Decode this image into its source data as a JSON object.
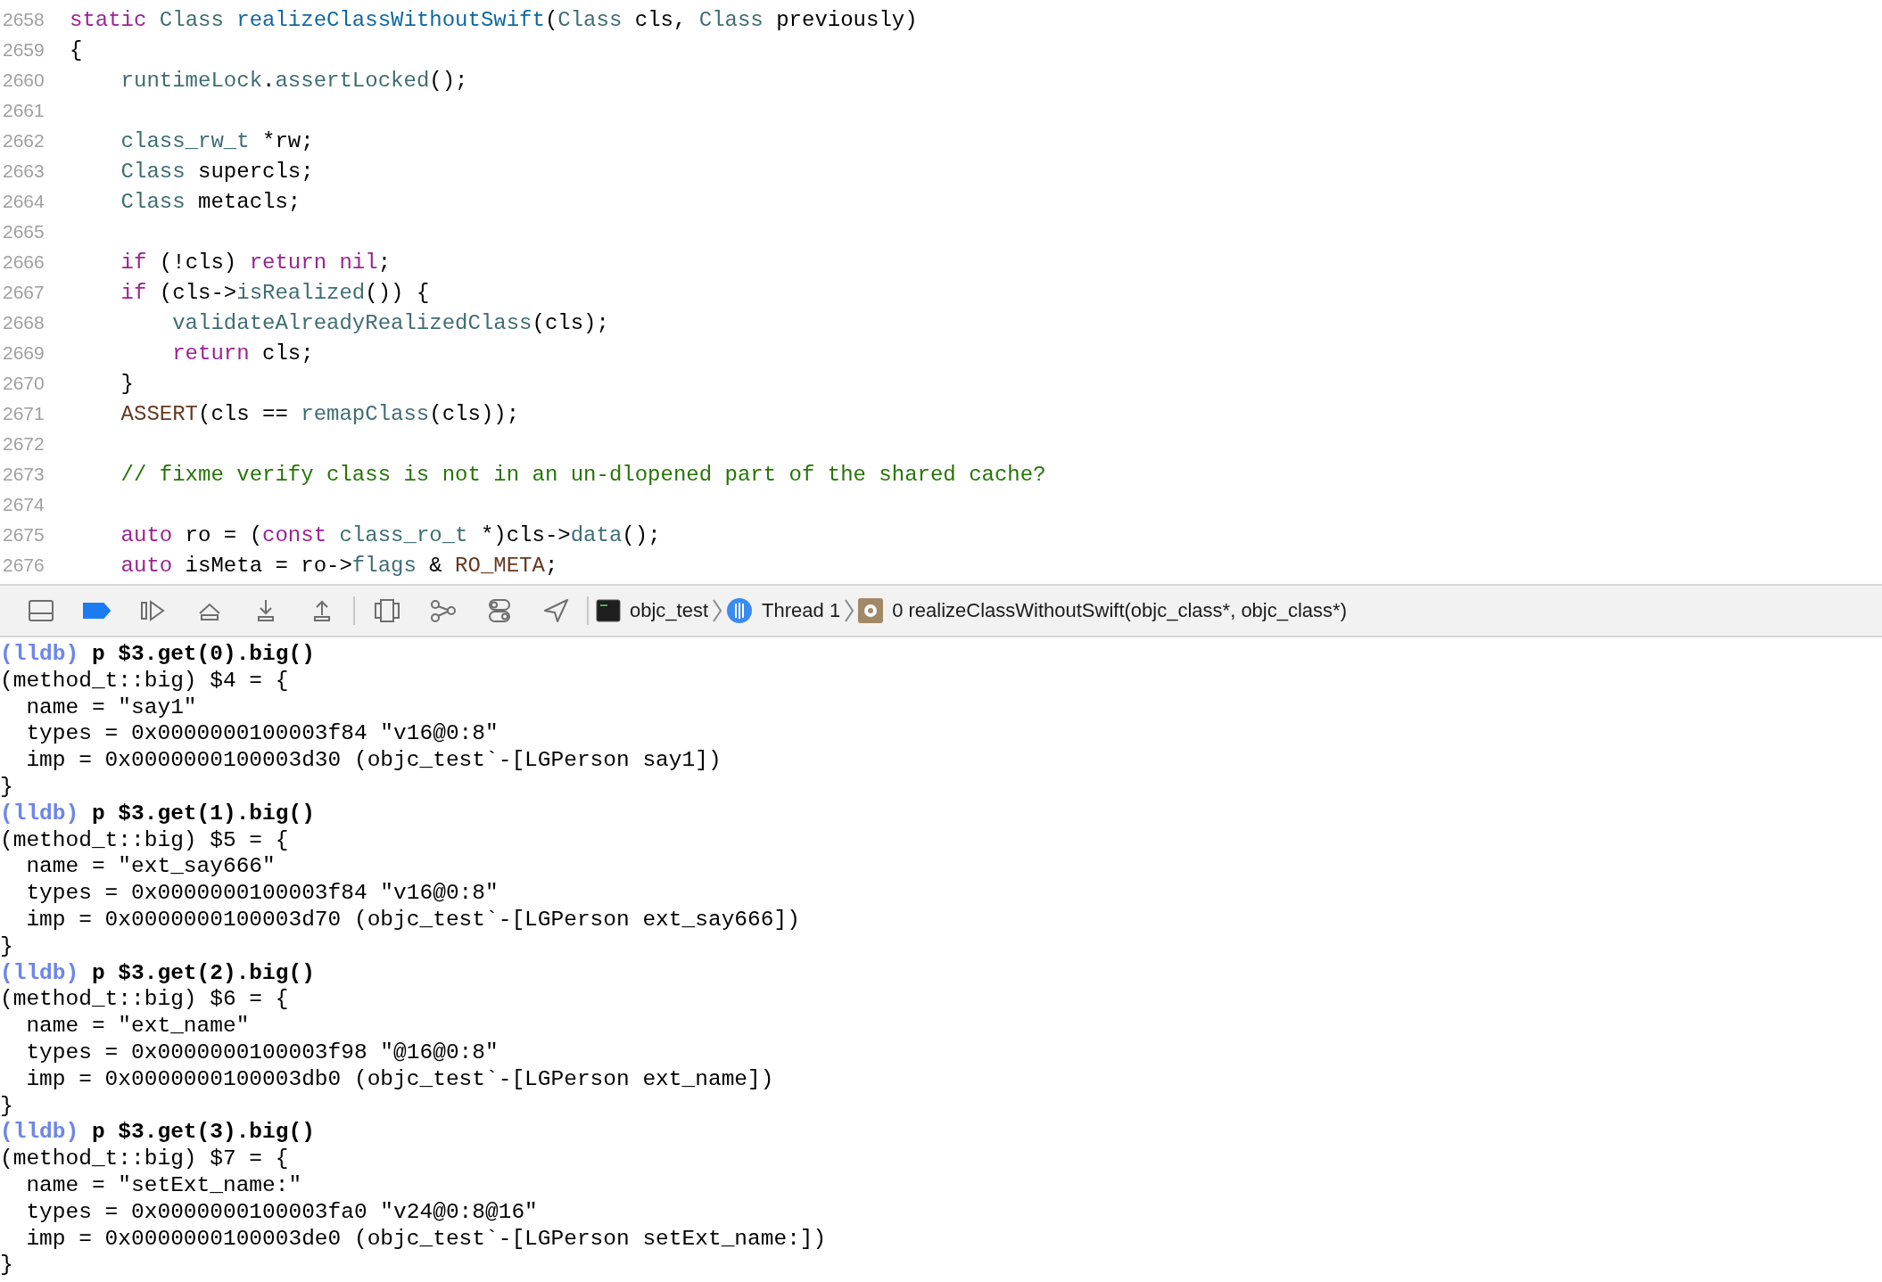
{
  "editor": {
    "lines": [
      {
        "number": "2658",
        "tokens": [
          {
            "kind": "keyword",
            "text": "static "
          },
          {
            "kind": "type",
            "text": "Class "
          },
          {
            "kind": "declaration",
            "text": "realizeClassWithoutSwift"
          },
          {
            "kind": "plain",
            "text": "("
          },
          {
            "kind": "type",
            "text": "Class"
          },
          {
            "kind": "plain",
            "text": " cls, "
          },
          {
            "kind": "type",
            "text": "Class"
          },
          {
            "kind": "plain",
            "text": " previously)"
          }
        ]
      },
      {
        "number": "2659",
        "tokens": [
          {
            "kind": "plain",
            "text": "{"
          }
        ]
      },
      {
        "number": "2660",
        "tokens": [
          {
            "kind": "type",
            "text": "    runtimeLock"
          },
          {
            "kind": "plain",
            "text": "."
          },
          {
            "kind": "type",
            "text": "assertLocked"
          },
          {
            "kind": "plain",
            "text": "();"
          }
        ]
      },
      {
        "number": "2661"
      },
      {
        "number": "2662",
        "tokens": [
          {
            "kind": "type",
            "text": "    class_rw_t"
          },
          {
            "kind": "plain",
            "text": " *rw;"
          }
        ]
      },
      {
        "number": "2663",
        "tokens": [
          {
            "kind": "type",
            "text": "    Class"
          },
          {
            "kind": "plain",
            "text": " supercls;"
          }
        ]
      },
      {
        "number": "2664",
        "tokens": [
          {
            "kind": "type",
            "text": "    Class"
          },
          {
            "kind": "plain",
            "text": " metacls;"
          }
        ]
      },
      {
        "number": "2665"
      },
      {
        "number": "2666",
        "tokens": [
          {
            "kind": "keyword",
            "text": "    if"
          },
          {
            "kind": "plain",
            "text": " (!cls) "
          },
          {
            "kind": "keyword",
            "text": "return nil"
          },
          {
            "kind": "plain",
            "text": ";"
          }
        ]
      },
      {
        "number": "2667",
        "tokens": [
          {
            "kind": "keyword",
            "text": "    if"
          },
          {
            "kind": "plain",
            "text": " (cls->"
          },
          {
            "kind": "type",
            "text": "isRealized"
          },
          {
            "kind": "plain",
            "text": "()) {"
          }
        ]
      },
      {
        "number": "2668",
        "tokens": [
          {
            "kind": "type",
            "text": "        validateAlreadyRealizedClass"
          },
          {
            "kind": "plain",
            "text": "(cls);"
          }
        ]
      },
      {
        "number": "2669",
        "tokens": [
          {
            "kind": "keyword",
            "text": "        return"
          },
          {
            "kind": "plain",
            "text": " cls;"
          }
        ]
      },
      {
        "number": "2670",
        "tokens": [
          {
            "kind": "plain",
            "text": "    }"
          }
        ]
      },
      {
        "number": "2671",
        "tokens": [
          {
            "kind": "macro",
            "text": "    ASSERT"
          },
          {
            "kind": "plain",
            "text": "(cls == "
          },
          {
            "kind": "type",
            "text": "remapClass"
          },
          {
            "kind": "plain",
            "text": "(cls));"
          }
        ]
      },
      {
        "number": "2672"
      },
      {
        "number": "2673",
        "tokens": [
          {
            "kind": "comment",
            "text": "    // fixme verify class is not in an un-dlopened part of the shared cache?"
          }
        ]
      },
      {
        "number": "2674"
      },
      {
        "number": "2675",
        "tokens": [
          {
            "kind": "keyword",
            "text": "    auto"
          },
          {
            "kind": "plain",
            "text": " ro = ("
          },
          {
            "kind": "keyword",
            "text": "const "
          },
          {
            "kind": "type",
            "text": "class_ro_t"
          },
          {
            "kind": "plain",
            "text": " *)cls->"
          },
          {
            "kind": "type",
            "text": "data"
          },
          {
            "kind": "plain",
            "text": "();"
          }
        ]
      },
      {
        "number": "2676",
        "tokens": [
          {
            "kind": "keyword",
            "text": "    auto"
          },
          {
            "kind": "plain",
            "text": " isMeta = ro->"
          },
          {
            "kind": "type",
            "text": "flags"
          },
          {
            "kind": "plain",
            "text": " & "
          },
          {
            "kind": "macro",
            "text": "RO_META"
          },
          {
            "kind": "plain",
            "text": ";"
          }
        ]
      }
    ]
  },
  "debug_bar": {
    "breakpoints_active": true,
    "breadcrumbs": [
      {
        "kind": "target",
        "text": "objc_test"
      },
      {
        "kind": "thread",
        "text": "Thread 1"
      },
      {
        "kind": "frame",
        "text": "0 realizeClassWithoutSwift(objc_class*, objc_class*)"
      }
    ]
  },
  "console": {
    "lines": [
      {
        "kind": "command",
        "prompt": "(lldb)",
        "text": "p $3.get(0).big()"
      },
      {
        "kind": "output",
        "text": "(method_t::big) $4 = {"
      },
      {
        "kind": "output",
        "text": "  name = \"say1\""
      },
      {
        "kind": "output",
        "text": "  types = 0x0000000100003f84 \"v16@0:8\""
      },
      {
        "kind": "output",
        "text": "  imp = 0x0000000100003d30 (objc_test`-[LGPerson say1])"
      },
      {
        "kind": "output",
        "text": "}"
      },
      {
        "kind": "command",
        "prompt": "(lldb)",
        "text": "p $3.get(1).big()"
      },
      {
        "kind": "output",
        "text": "(method_t::big) $5 = {"
      },
      {
        "kind": "output",
        "text": "  name = \"ext_say666\""
      },
      {
        "kind": "output",
        "text": "  types = 0x0000000100003f84 \"v16@0:8\""
      },
      {
        "kind": "output",
        "text": "  imp = 0x0000000100003d70 (objc_test`-[LGPerson ext_say666])"
      },
      {
        "kind": "output",
        "text": "}"
      },
      {
        "kind": "command",
        "prompt": "(lldb)",
        "text": "p $3.get(2).big()"
      },
      {
        "kind": "output",
        "text": "(method_t::big) $6 = {"
      },
      {
        "kind": "output",
        "text": "  name = \"ext_name\""
      },
      {
        "kind": "output",
        "text": "  types = 0x0000000100003f98 \"@16@0:8\""
      },
      {
        "kind": "output",
        "text": "  imp = 0x0000000100003db0 (objc_test`-[LGPerson ext_name])"
      },
      {
        "kind": "output",
        "text": "}"
      },
      {
        "kind": "command",
        "prompt": "(lldb)",
        "text": "p $3.get(3).big()"
      },
      {
        "kind": "output",
        "text": "(method_t::big) $7 = {"
      },
      {
        "kind": "output",
        "text": "  name = \"setExt_name:\""
      },
      {
        "kind": "output",
        "text": "  types = 0x0000000100003fa0 \"v24@0:8@16\""
      },
      {
        "kind": "output",
        "text": "  imp = 0x0000000100003de0 (objc_test`-[LGPerson setExt_name:])"
      },
      {
        "kind": "output",
        "text": "}"
      }
    ]
  }
}
